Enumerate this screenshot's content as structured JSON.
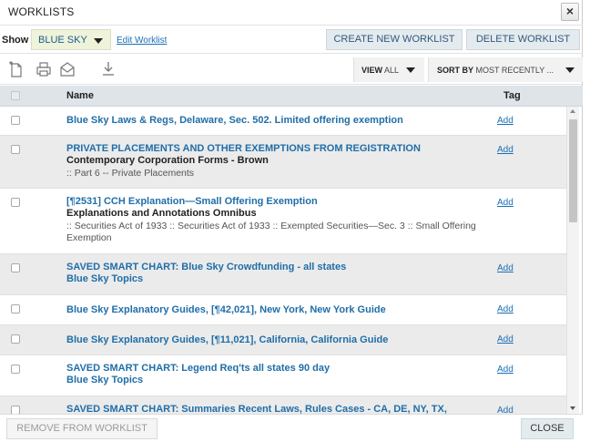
{
  "dialog": {
    "title": "WORKLISTS",
    "close_glyph": "×"
  },
  "showbar": {
    "label": "Show",
    "selected_worklist": "BLUE SKY",
    "edit_link": "Edit Worklist",
    "create_button": "CREATE NEW WORKLIST",
    "delete_button": "DELETE WORKLIST"
  },
  "toolbar": {
    "icons": [
      "new-document-icon",
      "print-icon",
      "email-icon",
      "download-icon"
    ],
    "view_label": "VIEW",
    "view_value": "ALL",
    "sort_label": "SORT BY",
    "sort_value": "MOST RECENTLY ..."
  },
  "table": {
    "headers": {
      "name": "Name",
      "tag": "Tag"
    },
    "rows": [
      {
        "title": "Blue Sky Laws & Regs, Delaware, Sec. 502. Limited offering exemption",
        "subtitle": "",
        "path": "",
        "tag": "Add"
      },
      {
        "title": "PRIVATE PLACEMENTS AND OTHER EXEMPTIONS FROM REGISTRATION",
        "subtitle": "Contemporary Corporation Forms - Brown",
        "path": ":: Part 6 -- Private Placements",
        "tag": "Add"
      },
      {
        "title": "[¶2531] CCH Explanation—Small Offering Exemption",
        "subtitle": "Explanations and Annotations Omnibus",
        "path": ":: Securities Act of 1933 :: Securities Act of 1933 :: Exempted Securities—Sec. 3 :: Small Offering Exemption",
        "tag": "Add"
      },
      {
        "title": "SAVED SMART CHART: Blue Sky Crowdfunding - all states",
        "subtitle": "Blue Sky Topics",
        "path": "",
        "tag": "Add"
      },
      {
        "title": "Blue Sky Explanatory Guides, [¶42,021], New York, New York Guide",
        "subtitle": "",
        "path": "",
        "tag": "Add"
      },
      {
        "title": "Blue Sky Explanatory Guides, [¶11,021], California, California Guide",
        "subtitle": "",
        "path": "",
        "tag": "Add"
      },
      {
        "title": "SAVED SMART CHART: Legend Req'ts all states 90 day",
        "subtitle": "Blue Sky Topics",
        "path": "",
        "tag": "Add"
      },
      {
        "title": "SAVED SMART CHART: Summaries Recent Laws, Rules Cases - CA, DE, NY, TX,",
        "subtitle": "",
        "path": "",
        "tag": "Add"
      }
    ]
  },
  "footer": {
    "remove_button": "REMOVE FROM WORKLIST",
    "close_button": "CLOSE"
  },
  "colors": {
    "link_blue": "#1f6ea8",
    "alt_row": "#ebebeb",
    "header_bg": "#dfe4e8",
    "button_bg": "#e4ebef",
    "select_bg": "#eef3da"
  }
}
